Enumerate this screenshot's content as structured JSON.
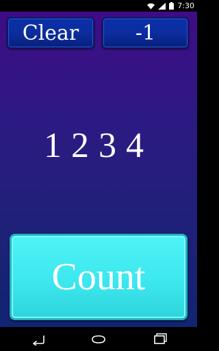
{
  "status_bar": {
    "time": "7:30",
    "icons": [
      "wifi-icon",
      "signal-icon",
      "battery-icon"
    ]
  },
  "buttons": {
    "clear_label": "Clear",
    "decrement_label": "-1",
    "count_label": "Count"
  },
  "counter": {
    "display": "1234"
  },
  "nav_bar": {
    "icons": [
      "back-icon",
      "home-icon",
      "recent-apps-icon"
    ]
  },
  "colors": {
    "background_top": "#3f0c86",
    "background_bottom": "#122472",
    "top_button": "#0b2d9e",
    "count_button": "#3ce8ee",
    "text": "#ffffff"
  }
}
